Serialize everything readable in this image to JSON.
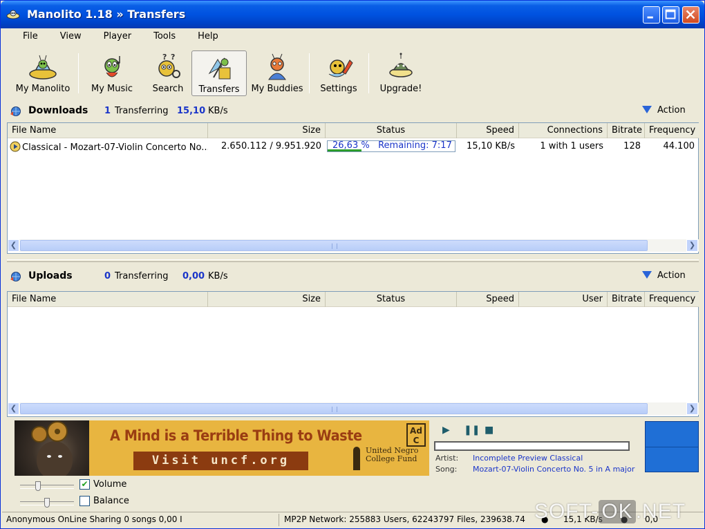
{
  "window": {
    "title": "Manolito 1.18 » Transfers"
  },
  "menu": [
    "File",
    "View",
    "Player",
    "Tools",
    "Help"
  ],
  "toolbar": [
    {
      "label": "My Manolito",
      "icon": "alien-ufo-icon"
    },
    {
      "label": "My Music",
      "icon": "alien-music-icon"
    },
    {
      "label": "Search",
      "icon": "alien-search-icon"
    },
    {
      "label": "Transfers",
      "icon": "transfers-icon",
      "active": true
    },
    {
      "label": "My Buddies",
      "icon": "alien-buddies-icon"
    },
    {
      "label": "Settings",
      "icon": "alien-settings-icon"
    },
    {
      "label": "Upgrade!",
      "icon": "alien-upgrade-icon"
    }
  ],
  "downloads": {
    "title": "Downloads",
    "count": "1",
    "transferring_label": "Transferring",
    "speed": "15,10",
    "speed_unit": "KB/s",
    "action_label": "Action",
    "columns": [
      "File Name",
      "Size",
      "Status",
      "Speed",
      "Connections",
      "Bitrate",
      "Frequency"
    ],
    "rows": [
      {
        "file_name": "Classical - Mozart-07-Violin Concerto No...",
        "size": "2.650.112 / 9.951.920",
        "status_percent": "26,63 %",
        "status_remaining": "Remaining: 7:17",
        "progress": 0.2663,
        "speed": "15,10 KB/s",
        "connections": "1 with 1 users",
        "bitrate": "128",
        "frequency": "44.100"
      }
    ]
  },
  "uploads": {
    "title": "Uploads",
    "count": "0",
    "transferring_label": "Transferring",
    "speed": "0,00",
    "speed_unit": "KB/s",
    "action_label": "Action",
    "columns": [
      "File Name",
      "Size",
      "Status",
      "Speed",
      "User",
      "Bitrate",
      "Frequency"
    ]
  },
  "ad": {
    "headline": "A Mind is a Terrible Thing to Waste",
    "visit": "Visit uncf.org",
    "ad_council": "Ad Council",
    "uncf_line1": "United Negro",
    "uncf_line2": "College Fund"
  },
  "player": {
    "artist_label": "Artist:",
    "artist": "Incomplete Preview Classical",
    "song_label": "Song:",
    "song": "Mozart-07-Violin Concerto No. 5 in A major",
    "volume_label": "Volume",
    "volume_checked": true,
    "balance_label": "Balance",
    "balance_checked": false
  },
  "statusbar": {
    "sharing": "Anonymous OnLine Sharing 0 songs 0,00 I",
    "network": "MP2P Network: 255883 Users, 62243797 Files, 239638.74",
    "down_speed": "15,1 KB/s",
    "up_speed": "0,0"
  },
  "watermark": {
    "left": "SOFT-",
    "box": "OK",
    "right": ".NET"
  },
  "colors": {
    "accent": "#1a35c9",
    "titlebar": "#0052e0",
    "progress": "#2c9c2c"
  }
}
